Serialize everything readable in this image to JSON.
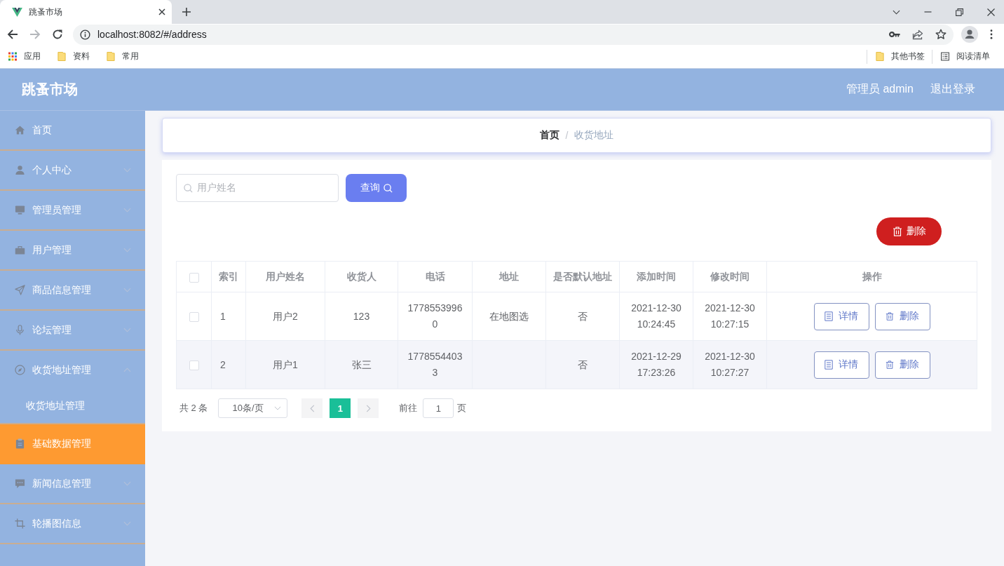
{
  "browser": {
    "tab": {
      "title": "跳蚤市场"
    },
    "url": "localhost:8082/#/address",
    "bookmarks": [
      {
        "label": "应用",
        "kind": "apps"
      },
      {
        "label": "资料",
        "kind": "folder"
      },
      {
        "label": "常用",
        "kind": "folder"
      }
    ],
    "bookmarks_right": [
      {
        "label": "其他书签",
        "kind": "folder"
      },
      {
        "label": "阅读清单",
        "kind": "list"
      }
    ]
  },
  "header": {
    "title": "跳蚤市场",
    "user": "管理员 admin",
    "logout": "退出登录"
  },
  "sidebar": {
    "items": [
      {
        "label": "首页",
        "kind": "link",
        "hovered": false
      },
      {
        "label": "个人中心",
        "kind": "menu",
        "expanded": false,
        "hovered": false
      },
      {
        "label": "管理员管理",
        "kind": "menu",
        "expanded": false,
        "hovered": false
      },
      {
        "label": "用户管理",
        "kind": "menu",
        "expanded": false,
        "hovered": false
      },
      {
        "label": "商品信息管理",
        "kind": "menu",
        "expanded": false,
        "hovered": false
      },
      {
        "label": "论坛管理",
        "kind": "menu",
        "expanded": false,
        "hovered": false
      },
      {
        "label": "收货地址管理",
        "kind": "menu",
        "expanded": true,
        "hovered": false,
        "children": [
          {
            "label": "收货地址管理",
            "hovered": false
          }
        ]
      },
      {
        "label": "基础数据管理",
        "kind": "link",
        "hovered": true
      },
      {
        "label": "新闻信息管理",
        "kind": "menu",
        "expanded": false,
        "hovered": false
      },
      {
        "label": "轮播图信息",
        "kind": "menu",
        "expanded": false,
        "hovered": false
      }
    ]
  },
  "breadcrumb": {
    "items": [
      "首页",
      "收货地址"
    ],
    "separator": "/"
  },
  "search": {
    "placeholder": "用户姓名",
    "button": "查询"
  },
  "delete_button": "删除",
  "table": {
    "header_checked": false,
    "columns": [
      "索引",
      "用户姓名",
      "收货人",
      "电话",
      "地址",
      "是否默认地址",
      "添加时间",
      "修改时间",
      "操作"
    ],
    "rows": [
      {
        "checked": false,
        "index": "1",
        "username": "用户2",
        "receiver": "123",
        "phone": "17785539960",
        "address": "在地图选",
        "is_default": "否",
        "added": "2021-12-30 10:24:45",
        "modified": "2021-12-30 10:27:15",
        "actions": [
          {
            "label": "详情",
            "kind": "detail"
          },
          {
            "label": "删除",
            "kind": "delete"
          }
        ]
      },
      {
        "checked": false,
        "index": "2",
        "username": "用户1",
        "receiver": "张三",
        "phone": "17785544033",
        "is_default": "否",
        "added": "2021-12-29 17:23:26",
        "modified": "2021-12-30 10:27:27",
        "actions": [
          {
            "label": "详情",
            "kind": "detail"
          },
          {
            "label": "删除",
            "kind": "delete"
          }
        ]
      }
    ]
  },
  "pagination": {
    "total": "共 2 条",
    "page_size": "10条/页",
    "prev_disabled": true,
    "pages": [
      {
        "label": "1",
        "selected": true
      }
    ],
    "next_disabled": true,
    "goto_label": "前往",
    "goto_value": "1",
    "goto_suffix": "页"
  }
}
